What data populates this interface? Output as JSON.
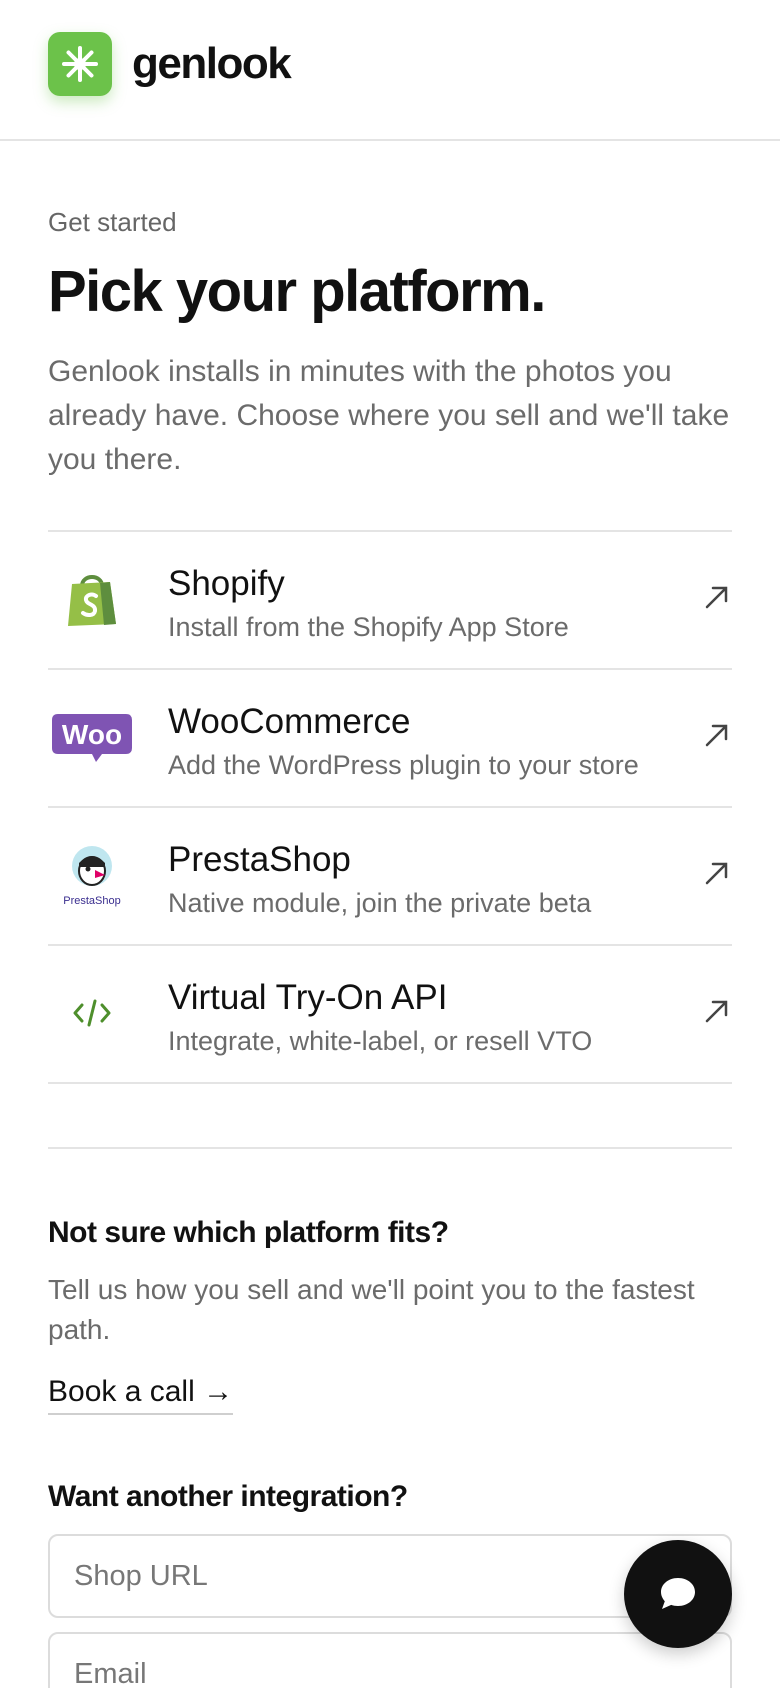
{
  "brand": {
    "name": "genlook",
    "accent": "#6cc24a"
  },
  "intro": {
    "eyebrow": "Get started",
    "title": "Pick your platform.",
    "lead": "Genlook installs in minutes with the photos you already have. Choose where you sell and we'll take you there."
  },
  "platforms": [
    {
      "name": "Shopify",
      "description": "Install from the Shopify App Store",
      "icon": "shopify-bag-icon"
    },
    {
      "name": "WooCommerce",
      "description": "Add the WordPress plugin to your store",
      "icon": "woo-logo-icon"
    },
    {
      "name": "PrestaShop",
      "description": "Native module, join the private beta",
      "icon": "prestashop-puffin-icon",
      "logo_text": "PrestaShop"
    },
    {
      "name": "Virtual Try-On API",
      "description": "Integrate, white-label, or resell VTO",
      "icon": "code-brackets-icon"
    }
  ],
  "help": {
    "title": "Not sure which platform fits?",
    "text": "Tell us how you sell and we'll point you to the fastest path.",
    "cta": "Book a call →"
  },
  "request": {
    "title": "Want another integration?",
    "shop_url_placeholder": "Shop URL",
    "email_placeholder": "Email"
  },
  "icons": {
    "arrow": "arrow-up-right-icon",
    "chat": "chat-bubble-icon",
    "logo": "sparkle-icon"
  }
}
